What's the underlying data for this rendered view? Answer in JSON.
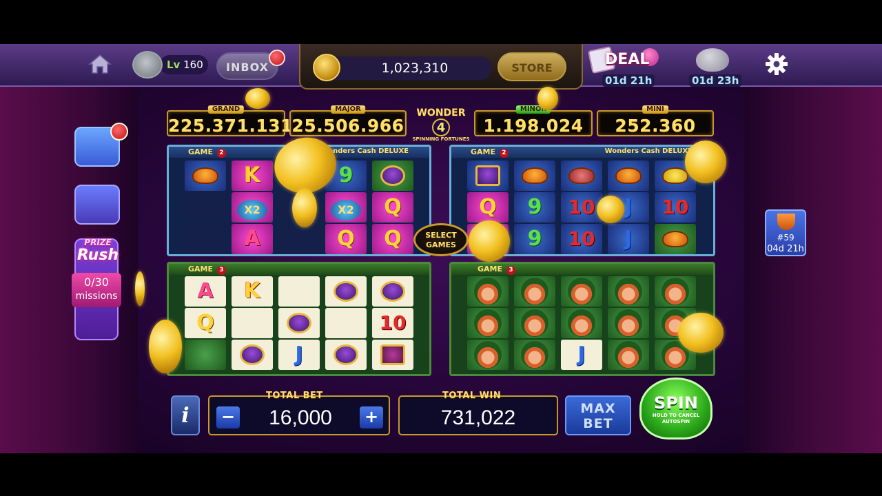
{
  "topbar": {
    "level_prefix": "Lv",
    "level_value": "160",
    "inbox_label": "INBOX",
    "coins": "1,023,310",
    "store_label": "STORE",
    "deal_label": "DEAL",
    "deal_timer": "01d 21h",
    "piggy_timer": "01d 23h"
  },
  "sidebar": {
    "prize_rush_line1": "PRIZE",
    "prize_rush_line2": "Rush",
    "missions_count": "0/30",
    "missions_label": "missions"
  },
  "trophy": {
    "rank": "#59",
    "timer": "04d 21h"
  },
  "jackpots": [
    {
      "label": "GRAND",
      "value": "225.371.131"
    },
    {
      "label": "MAJOR",
      "value": "25.506.966"
    },
    {
      "label": "MINOR",
      "value": "1.198.024"
    },
    {
      "label": "MINI",
      "value": "252.360"
    }
  ],
  "wonder": {
    "line1": "WONDER",
    "number": "4",
    "line2": "SPINNING FORTUNES"
  },
  "games": {
    "top_left": {
      "label": "GAME",
      "count": "2",
      "title": "Wonders Cash DELUXE"
    },
    "top_right": {
      "label": "GAME",
      "count": "2",
      "title": "Wonders Cash DELUXE"
    },
    "bottom_left": {
      "label": "GAME",
      "count": "3"
    },
    "bottom_right": {
      "label": "GAME",
      "count": "3"
    }
  },
  "select_games": {
    "line1": "SELECT",
    "line2": "GAMES"
  },
  "bottom": {
    "info_label": "i",
    "total_bet_label": "TOTAL BET",
    "total_bet_value": "16,000",
    "minus": "−",
    "plus": "+",
    "total_win_label": "TOTAL WIN",
    "total_win_value": "731,022",
    "max_bet_line1": "MAX",
    "max_bet_line2": "BET",
    "spin_label": "SPIN",
    "spin_sub1": "HOLD TO CANCEL",
    "spin_sub2": "AUTOSPIN"
  },
  "symbols": {
    "K": "K",
    "Q": "Q",
    "A": "A",
    "J": "J",
    "nine": "9",
    "ten": "10",
    "x2": "X2",
    "shamrock": "♣"
  },
  "colors": {
    "jackpot_text": "#ffe16a",
    "spin_green": "#2aa81a",
    "accent_gold": "#c89a2a"
  }
}
